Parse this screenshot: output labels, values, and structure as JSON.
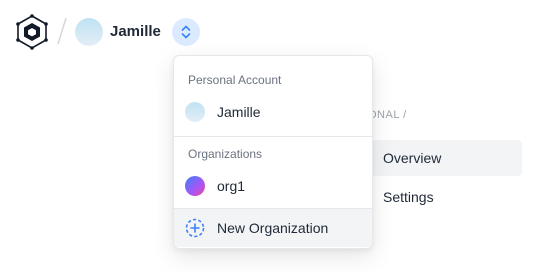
{
  "header": {
    "user_name": "Jamille"
  },
  "background_page": {
    "breadcrumb": "ONAL /",
    "nav_items": [
      {
        "label": "Overview",
        "active": true
      },
      {
        "label": "Settings",
        "active": false
      }
    ]
  },
  "dropdown": {
    "personal_section_label": "Personal Account",
    "personal_account_name": "Jamille",
    "organizations_section_label": "Organizations",
    "organizations": [
      {
        "name": "org1"
      }
    ],
    "new_org_label": "New Organization"
  },
  "colors": {
    "accent": "#3b82f6",
    "switcher_bg": "#dbeafe",
    "hover_row_bg": "#f3f4f6"
  },
  "icons": {
    "logo": "hexagon-logo-icon",
    "switcher": "chevron-up-down-icon",
    "new_org": "plus-circle-dashed-icon"
  }
}
